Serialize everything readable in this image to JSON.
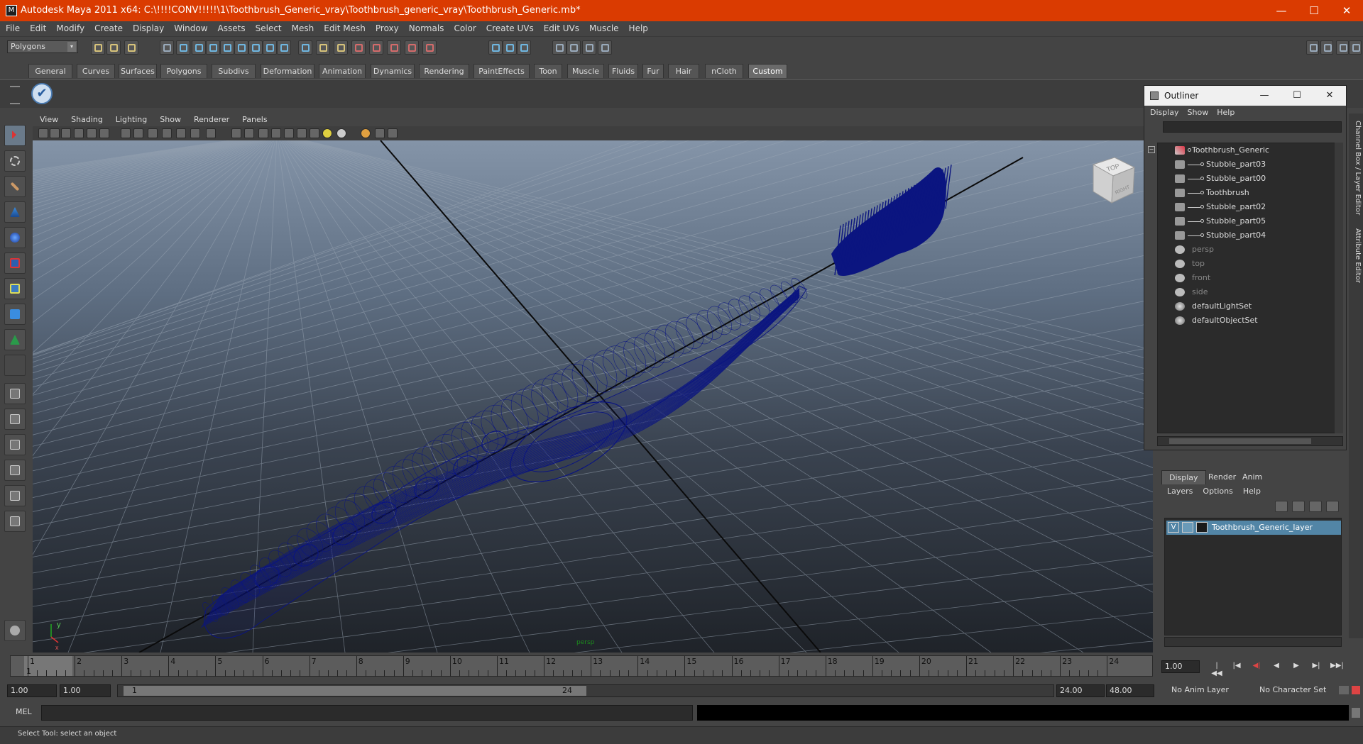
{
  "window": {
    "title": "Autodesk Maya 2011 x64: C:\\!!!!CONV!!!!!\\1\\Toothbrush_Generic_vray\\Toothbrush_generic_vray\\Toothbrush_Generic.mb*",
    "minimize": "—",
    "maximize": "☐",
    "close": "✕",
    "accent": "#da3b01"
  },
  "menubar": [
    "File",
    "Edit",
    "Modify",
    "Create",
    "Display",
    "Window",
    "Assets",
    "Select",
    "Mesh",
    "Edit Mesh",
    "Proxy",
    "Normals",
    "Color",
    "Create UVs",
    "Edit UVs",
    "Muscle",
    "Help"
  ],
  "mode_selector": {
    "value": "Polygons",
    "arrow": "▾"
  },
  "shelf_tabs": [
    "General",
    "Curves",
    "Surfaces",
    "Polygons",
    "Subdivs",
    "Deformation",
    "Animation",
    "Dynamics",
    "Rendering",
    "PaintEffects",
    "Toon",
    "Muscle",
    "Fluids",
    "Fur",
    "Hair",
    "nCloth",
    "Custom"
  ],
  "shelf_active_tab": "Custom",
  "shelf_check_icon": "✔",
  "panel_menu": [
    "View",
    "Shading",
    "Lighting",
    "Show",
    "Renderer",
    "Panels"
  ],
  "viewport": {
    "viewcube_label": "TOP",
    "viewcube_side": "RIGHT",
    "axis_y": "y",
    "axis_x": "x",
    "camera_name": "persp",
    "wire_color": "#0b1580"
  },
  "outliner": {
    "title": "Outliner",
    "menu": [
      "Display",
      "Show",
      "Help"
    ],
    "items": [
      {
        "label": "Toothbrush_Generic",
        "icon": "group-icon",
        "dim": false
      },
      {
        "label": "Stubble_part03",
        "icon": "mesh-icon",
        "dim": false
      },
      {
        "label": "Stubble_part00",
        "icon": "mesh-icon",
        "dim": false
      },
      {
        "label": "Toothbrush",
        "icon": "mesh-icon",
        "dim": false
      },
      {
        "label": "Stubble_part02",
        "icon": "mesh-icon",
        "dim": false
      },
      {
        "label": "Stubble_part05",
        "icon": "mesh-icon",
        "dim": false
      },
      {
        "label": "Stubble_part04",
        "icon": "mesh-icon",
        "dim": false
      },
      {
        "label": "persp",
        "icon": "camera-icon",
        "dim": true
      },
      {
        "label": "top",
        "icon": "camera-icon",
        "dim": true
      },
      {
        "label": "front",
        "icon": "camera-icon",
        "dim": true
      },
      {
        "label": "side",
        "icon": "camera-icon",
        "dim": true
      },
      {
        "label": "defaultLightSet",
        "icon": "set-icon",
        "dim": false
      },
      {
        "label": "defaultObjectSet",
        "icon": "set-icon",
        "dim": false
      }
    ]
  },
  "side_tabs": [
    "Channel Box / Layer Editor",
    "Attribute Editor"
  ],
  "layers": {
    "tabs": [
      "Display",
      "Render",
      "Anim"
    ],
    "active_tab": "Display",
    "menu": [
      "Layers",
      "Options",
      "Help"
    ],
    "rows": [
      {
        "visible": "V",
        "name": "Toothbrush_Generic_layer"
      }
    ]
  },
  "timeline": {
    "ticks": [
      "1",
      "2",
      "3",
      "4",
      "5",
      "6",
      "7",
      "8",
      "9",
      "10",
      "11",
      "12",
      "13",
      "14",
      "15",
      "16",
      "17",
      "18",
      "19",
      "20",
      "21",
      "22",
      "23",
      "24"
    ],
    "current_frame": "1",
    "current_time_field": "1.00"
  },
  "playback_buttons": [
    "|◀◀",
    "|◀",
    "◀|",
    "◀",
    "▶",
    "▶|",
    "▶▶|"
  ],
  "range": {
    "start": "1.00",
    "anim_start": "1.00",
    "slider_start": "1",
    "slider_end": "24",
    "end": "24.00",
    "anim_end": "48.00",
    "anim_layer": "No Anim Layer",
    "character_set": "No Character Set"
  },
  "command": {
    "label": "MEL"
  },
  "help_line": "Select Tool: select an object"
}
